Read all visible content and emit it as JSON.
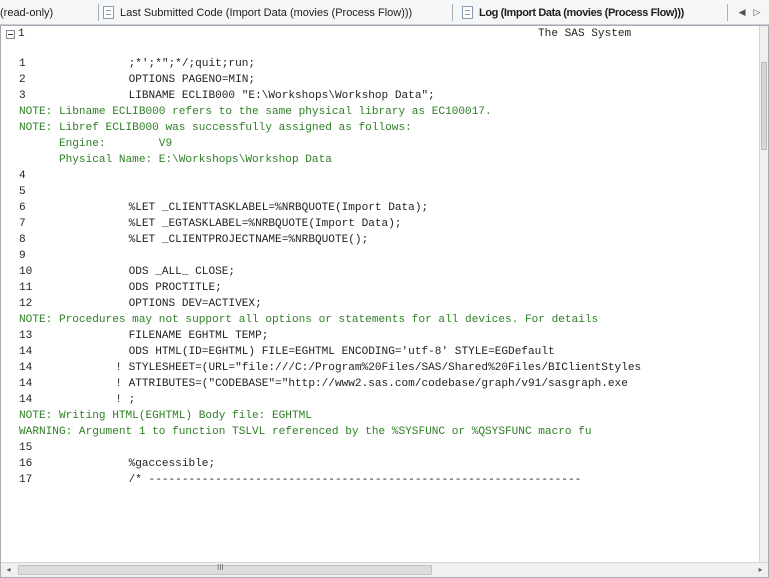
{
  "tabs": {
    "readonly_label": "(read-only)",
    "last_submitted_label": "Last Submitted Code (Import Data (movies (Process Flow)))",
    "log_label": "Log (Import Data (movies (Process Flow)))",
    "nav_left": "◀",
    "nav_right": "▷"
  },
  "log": {
    "page_number": "1",
    "system_title": "The SAS System",
    "lines": [
      {
        "num": "1",
        "type": "code",
        "text": "          ;*';*\";*/;quit;run;"
      },
      {
        "num": "2",
        "type": "code",
        "text": "          OPTIONS PAGENO=MIN;"
      },
      {
        "num": "3",
        "type": "code",
        "text": "          LIBNAME ECLIB000 \"E:\\Workshops\\Workshop Data\";"
      },
      {
        "num": "",
        "type": "note",
        "text": "NOTE: Libname ECLIB000 refers to the same physical library as EC100017."
      },
      {
        "num": "",
        "type": "note",
        "text": "NOTE: Libref ECLIB000 was successfully assigned as follows:"
      },
      {
        "num": "",
        "type": "note",
        "text": "      Engine:        V9"
      },
      {
        "num": "",
        "type": "note",
        "text": "      Physical Name: E:\\Workshops\\Workshop Data"
      },
      {
        "num": "4",
        "type": "code",
        "text": ""
      },
      {
        "num": "5",
        "type": "code",
        "text": ""
      },
      {
        "num": "6",
        "type": "code",
        "text": "          %LET _CLIENTTASKLABEL=%NRBQUOTE(Import Data);"
      },
      {
        "num": "7",
        "type": "code",
        "text": "          %LET _EGTASKLABEL=%NRBQUOTE(Import Data);"
      },
      {
        "num": "8",
        "type": "code",
        "text": "          %LET _CLIENTPROJECTNAME=%NRBQUOTE();"
      },
      {
        "num": "9",
        "type": "code",
        "text": ""
      },
      {
        "num": "10",
        "type": "code",
        "text": "          ODS _ALL_ CLOSE;"
      },
      {
        "num": "11",
        "type": "code",
        "text": "          ODS PROCTITLE;"
      },
      {
        "num": "12",
        "type": "code",
        "text": "          OPTIONS DEV=ACTIVEX;"
      },
      {
        "num": "",
        "type": "note",
        "text": "NOTE: Procedures may not support all options or statements for all devices. For details"
      },
      {
        "num": "13",
        "type": "code",
        "text": "          FILENAME EGHTML TEMP;"
      },
      {
        "num": "14",
        "type": "code",
        "text": "          ODS HTML(ID=EGHTML) FILE=EGHTML ENCODING='utf-8' STYLE=EGDefault"
      },
      {
        "num": "14",
        "type": "code",
        "text": "        ! STYLESHEET=(URL=\"file:///C:/Program%20Files/SAS/Shared%20Files/BIClientStyles"
      },
      {
        "num": "14",
        "type": "code",
        "text": "        ! ATTRIBUTES=(\"CODEBASE\"=\"http://www2.sas.com/codebase/graph/v91/sasgraph.exe"
      },
      {
        "num": "14",
        "type": "code",
        "text": "        ! ;"
      },
      {
        "num": "",
        "type": "note",
        "text": "NOTE: Writing HTML(EGHTML) Body file: EGHTML"
      },
      {
        "num": "",
        "type": "warning",
        "text": "WARNING: Argument 1 to function TSLVL referenced by the %SYSFUNC or %QSYSFUNC macro fu"
      },
      {
        "num": "15",
        "type": "code",
        "text": ""
      },
      {
        "num": "16",
        "type": "code",
        "text": "          %gaccessible;"
      },
      {
        "num": "17",
        "type": "code",
        "text": "          /* -----------------------------------------------------------------"
      }
    ]
  },
  "scrollbars": {
    "hscroll_grip": "III"
  },
  "colors": {
    "note_text": "#2e7f25",
    "code_text": "#1f1f1f",
    "tab_bg": "#f5f6f8"
  },
  "icons": {
    "tab_document": "document-icon",
    "collapse": "collapse-minus-icon"
  }
}
